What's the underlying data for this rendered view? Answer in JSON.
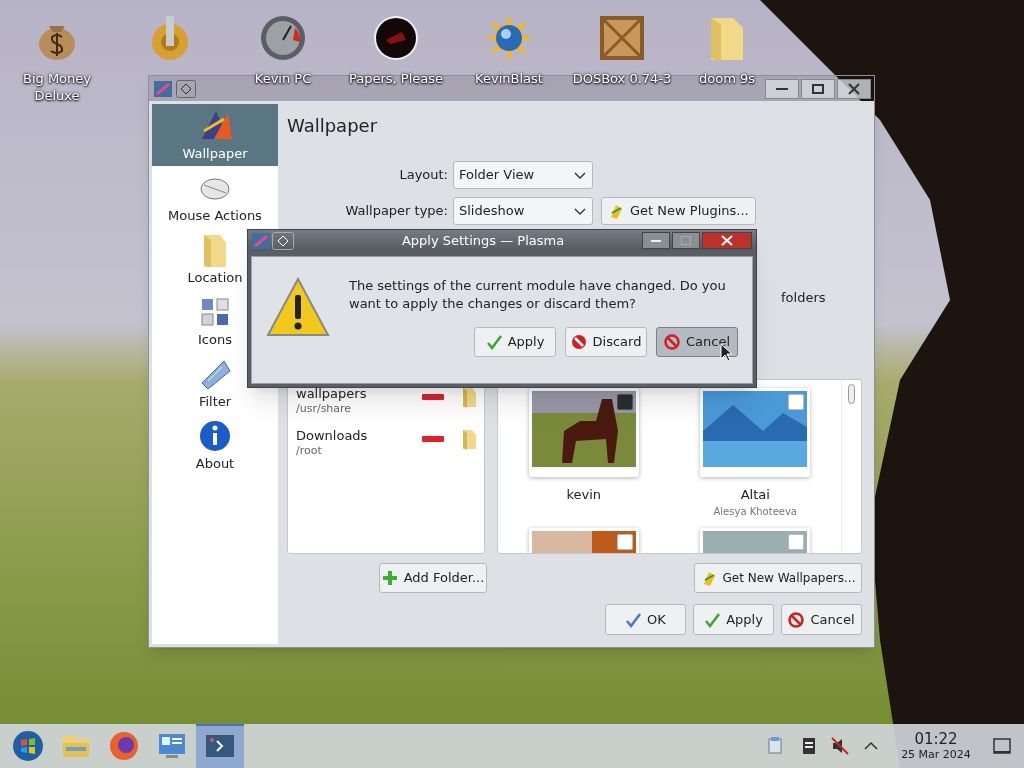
{
  "desktop_icons": [
    {
      "kind": "money",
      "label": "Big Money\nDeluxe"
    },
    {
      "kind": "gear"
    },
    {
      "kind": "gauge",
      "label": "Kevin PC"
    },
    {
      "kind": "disc",
      "label": "Papers, Please"
    },
    {
      "kind": "sun",
      "label": "KevinBlast"
    },
    {
      "kind": "crate",
      "label": "DOSBox 0.74-3"
    },
    {
      "kind": "folder",
      "label": "doom 9s"
    }
  ],
  "window": {
    "sidebar": [
      {
        "kind": "wallpaper",
        "label": "Wallpaper",
        "selected": true
      },
      {
        "kind": "mouse",
        "label": "Mouse Actions",
        "selected": false
      },
      {
        "kind": "folder",
        "label": "Location",
        "selected": false
      },
      {
        "kind": "icons",
        "label": "Icons",
        "selected": false
      },
      {
        "kind": "filter",
        "label": "Filter",
        "selected": false
      },
      {
        "kind": "about",
        "label": "About",
        "selected": false
      }
    ],
    "page_title": "Wallpaper",
    "form": [
      {
        "label": "Layout:",
        "value": "Folder View"
      },
      {
        "label": "Wallpaper type:",
        "value": "Slideshow",
        "button": "Get New Plugins..."
      }
    ],
    "partial_text": "folders",
    "folders": [
      {
        "name": "wallpapers",
        "path": "/usr/share"
      },
      {
        "name": "Downloads",
        "path": "/root"
      }
    ],
    "wallpapers": [
      {
        "kind": "horse",
        "name": "kevin",
        "checked": true
      },
      {
        "kind": "lake",
        "name": "Altai",
        "author": "Alesya Khoteeva",
        "checked": false
      },
      {
        "kind": "sunset",
        "checked": false
      },
      {
        "kind": "shore",
        "checked": false
      }
    ],
    "add_folder_button": "Add Folder...",
    "get_wallpapers_button": "Get New Wallpapers...",
    "buttons": [
      {
        "kind": "ok",
        "label": "OK"
      },
      {
        "kind": "apply",
        "label": "Apply"
      },
      {
        "kind": "cancel",
        "label": "Cancel"
      }
    ]
  },
  "dialog": {
    "title": "Apply Settings — Plasma",
    "message": "The settings of the current module have changed. Do you want to apply the changes or discard them?",
    "buttons": [
      {
        "kind": "apply",
        "label": "Apply",
        "focused": false
      },
      {
        "kind": "discard",
        "label": "Discard",
        "focused": false
      },
      {
        "kind": "cancel",
        "label": "Cancel",
        "focused": true
      }
    ]
  },
  "taskbar": {
    "apps": [
      {
        "kind": "start",
        "selected": false
      },
      {
        "kind": "files",
        "selected": false
      },
      {
        "kind": "browser",
        "selected": false
      },
      {
        "kind": "monitor",
        "selected": false
      },
      {
        "kind": "settings",
        "selected": true
      }
    ],
    "clock": {
      "time": "01:22",
      "date": "25 Mar 2024"
    }
  }
}
